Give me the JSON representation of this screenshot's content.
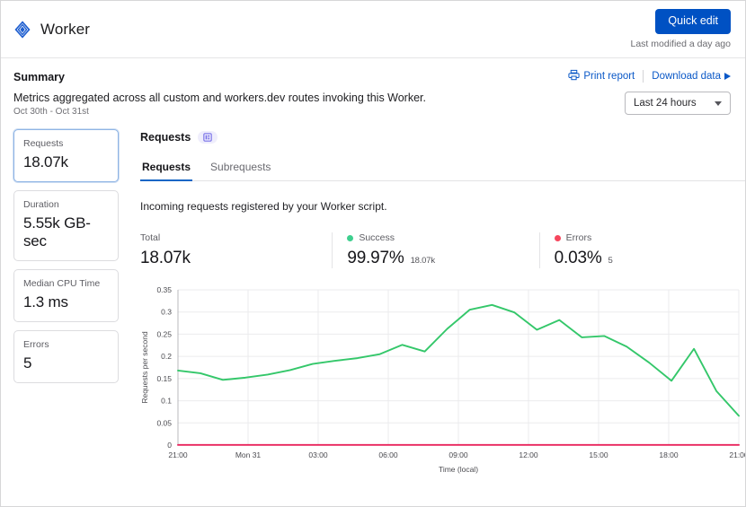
{
  "titlebar": {
    "logo_icon": "workers-diamond-icon",
    "title": "Worker",
    "quick_edit_label": "Quick edit",
    "last_modified": "Last modified a day ago"
  },
  "summary": {
    "heading": "Summary",
    "description": "Metrics aggregated across all custom and workers.dev routes invoking this Worker.",
    "date_range": "Oct 30th - Oct 31st",
    "print_report_label": "Print report",
    "print_report_icon": "printer-icon",
    "download_data_label": "Download data",
    "download_data_icon": "play-triangle-icon",
    "time_range_value": "Last 24 hours",
    "time_range_icon": "chevron-down-icon"
  },
  "metrics": [
    {
      "label": "Requests",
      "value": "18.07k",
      "active": true
    },
    {
      "label": "Duration",
      "value": "5.55k GB-sec",
      "active": false
    },
    {
      "label": "Median CPU Time",
      "value": "1.3 ms",
      "active": false
    },
    {
      "label": "Errors",
      "value": "5",
      "active": false
    }
  ],
  "panel": {
    "title": "Requests",
    "badge_icon": "chart-badge-icon",
    "tabs": [
      {
        "label": "Requests",
        "active": true
      },
      {
        "label": "Subrequests",
        "active": false
      }
    ],
    "description": "Incoming requests registered by your Worker script.",
    "stats": [
      {
        "label": "Total",
        "value": "18.07k",
        "sub": "",
        "color": ""
      },
      {
        "label": "Success",
        "value": "99.97%",
        "sub": "18.07k",
        "color": "#3ecf8e"
      },
      {
        "label": "Errors",
        "value": "0.03%",
        "sub": "5",
        "color": "#f6465d"
      }
    ]
  },
  "colors": {
    "accent": "#0051c3",
    "link": "#0a58c7",
    "success": "#3ecf8e",
    "error": "#f6465d",
    "success_line": "#34c76a",
    "error_line": "#e8235c",
    "grid": "#ebebed",
    "badge_bg": "#efeefc",
    "badge_fg": "#7b73e8"
  },
  "chart_data": {
    "type": "line",
    "title": "",
    "xlabel": "Time (local)",
    "ylabel": "Requests per second",
    "ylim": [
      0,
      0.35
    ],
    "yticks": [
      "0",
      "0.05",
      "0.1",
      "0.15",
      "0.2",
      "0.25",
      "0.3",
      "0.35"
    ],
    "ytick_values": [
      0,
      0.05,
      0.1,
      0.15,
      0.2,
      0.25,
      0.3,
      0.35
    ],
    "xticks": [
      "21:00",
      "Mon 31",
      "03:00",
      "06:00",
      "09:00",
      "12:00",
      "15:00",
      "18:00",
      "21:00"
    ],
    "xtick_positions": [
      0,
      3,
      6,
      9,
      12,
      15,
      18,
      21,
      24
    ],
    "xlim": [
      0,
      24
    ],
    "grid": true,
    "legend": "none",
    "series": [
      {
        "name": "Success",
        "color": "#34c76a",
        "x": [
          0,
          1,
          2,
          3,
          4,
          5,
          6,
          7,
          8,
          9,
          10,
          11,
          12,
          13,
          14,
          15,
          16,
          17,
          18,
          19,
          20,
          21,
          22,
          23,
          24
        ],
        "values": [
          0.168,
          0.162,
          0.147,
          0.152,
          0.159,
          0.169,
          0.183,
          0.19,
          0.196,
          0.205,
          0.226,
          0.211,
          0.262,
          0.305,
          0.316,
          0.299,
          0.26,
          0.282,
          0.243,
          0.246,
          0.222,
          0.186,
          0.145,
          0.217,
          0.122,
          0.066
        ]
      },
      {
        "name": "Errors",
        "color": "#e8235c",
        "x": [
          0,
          24
        ],
        "values": [
          0.0003,
          0.0003
        ]
      }
    ]
  }
}
